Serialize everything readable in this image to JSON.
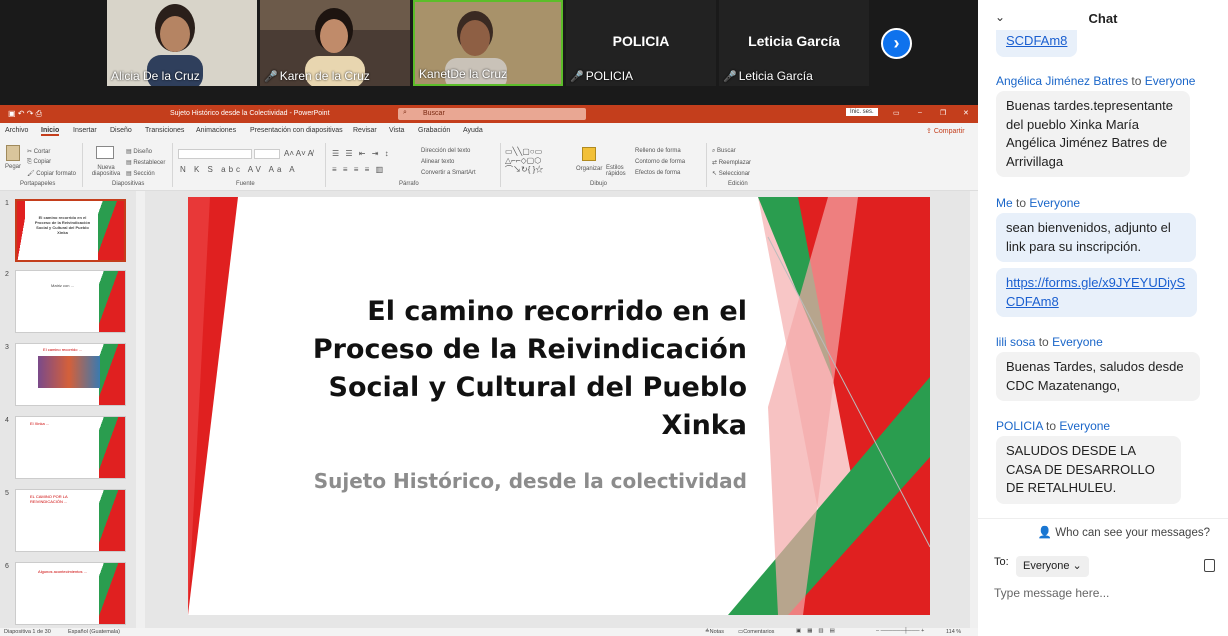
{
  "participants": [
    {
      "name": "Alicia De la Cruz",
      "muted": false,
      "video": true
    },
    {
      "name": "Karen de la Cruz",
      "muted": true,
      "video": true
    },
    {
      "name": "KanetDe la Cruz",
      "muted": false,
      "video": true
    },
    {
      "name": "POLICIA",
      "muted": true,
      "video": false
    },
    {
      "name": "Leticia García",
      "muted": true,
      "video": false
    }
  ],
  "ppt": {
    "title": "Sujeto Histórico desde la Colectividad - PowerPoint",
    "search_placeholder": "Buscar",
    "user_badge": "Inic. ses.",
    "share": "Compartir",
    "menu": [
      "Archivo",
      "Inicio",
      "Insertar",
      "Diseño",
      "Transiciones",
      "Animaciones",
      "Presentación con diapositivas",
      "Revisar",
      "Vista",
      "Grabación",
      "Ayuda"
    ],
    "ribbon": {
      "groups": [
        "Portapapeles",
        "Diapositivas",
        "Fuente",
        "Párrafo",
        "Dibujo",
        "Edición"
      ],
      "paste": "Pegar",
      "cut": "Cortar",
      "copy": "Copiar",
      "format_painter": "Copiar formato",
      "new_slide": "Nueva diapositiva",
      "layout": "Diseño",
      "reset": "Restablecer",
      "section": "Sección",
      "text_direction": "Dirección del texto",
      "align_text": "Alinear texto",
      "smartart": "Convertir a SmartArt",
      "arrange": "Organizar",
      "quick_styles": "Estilos rápidos",
      "shape_fill": "Relleno de forma",
      "shape_outline": "Contorno de forma",
      "shape_effects": "Efectos de forma",
      "find": "Buscar",
      "replace": "Reemplazar",
      "select": "Seleccionar"
    },
    "thumbnails": [
      {
        "num": "1",
        "text": "El camino recorrido en el Proceso de la Reivindicación Social y Cultural del Pueblo Xinka"
      },
      {
        "num": "2",
        "text": "Matriz con ..."
      },
      {
        "num": "3",
        "text": "El camino recorrido ..."
      },
      {
        "num": "4",
        "text": "El Xinka ..."
      },
      {
        "num": "5",
        "text": "EL CAMINO POR LA REIVINDICACIÓN ..."
      },
      {
        "num": "6",
        "text": "Algunos acontecimientos ..."
      }
    ],
    "slide": {
      "title": "El camino recorrido en el Proceso de la Reivindicación Social y Cultural del Pueblo Xinka",
      "subtitle": "Sujeto Histórico, desde la colectividad"
    },
    "status": {
      "slide_info": "Diapositiva 1 de 30",
      "language": "Español (Guatemala)",
      "notes": "Notas",
      "comments": "Comentarios",
      "zoom": "114 %"
    }
  },
  "chat": {
    "title": "Chat",
    "messages": [
      {
        "sender": "",
        "to": "",
        "text": "SCDFAm8",
        "link": true,
        "bubble": "blue"
      },
      {
        "sender": "Angélica Jiménez Batres",
        "to": "Everyone",
        "text": "Buenas tardes.tepresentante del pueblo Xinka María Angélica Jiménez Batres de Arrivillaga",
        "bubble": "gray"
      },
      {
        "sender": "Me",
        "to": "Everyone",
        "text": "sean bienvenidos, adjunto el link para su inscripción.",
        "bubble": "blue"
      },
      {
        "sender": "",
        "to": "",
        "text": "https://forms.gle/x9JYEYUDiySCDFAm8",
        "link": true,
        "bubble": "blue"
      },
      {
        "sender": "lili sosa",
        "to": "Everyone",
        "text": "Buenas Tardes, saludos desde CDC Mazatenango,",
        "bubble": "gray"
      },
      {
        "sender": "POLICIA",
        "to": "Everyone",
        "text": "SALUDOS DESDE LA CASA DE DESARROLLO DE RETALHULEU.",
        "bubble": "gray"
      }
    ],
    "to_word": "to",
    "who_can_see": "Who can see your messages?",
    "to_label": "To:",
    "recipient": "Everyone",
    "input_placeholder": "Type message here..."
  },
  "colors": {
    "ppt_accent": "#c43e1c",
    "slide_red": "#e02020",
    "slide_green": "#2a9d4f",
    "zoom_blue": "#0e72ed"
  }
}
